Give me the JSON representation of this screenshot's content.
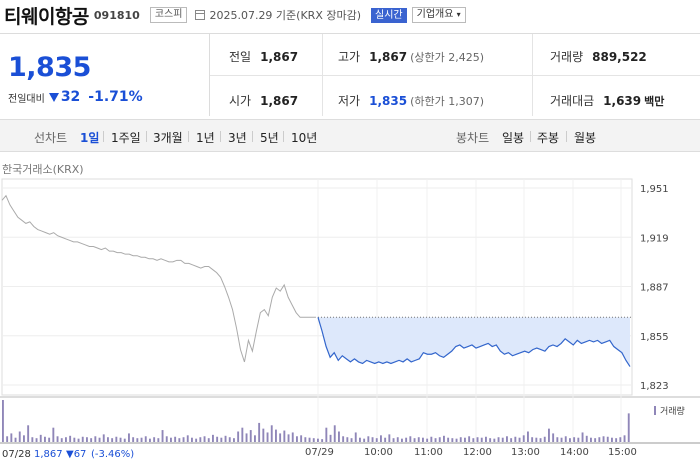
{
  "stock": {
    "name": "티웨이항공",
    "code": "091810",
    "market": "코스피",
    "date": "2025.07.29 기준(KRX 장마감)",
    "realtime": "실시간",
    "company_info": "기업개요"
  },
  "price": {
    "current": "1,835",
    "change_label": "전일대비",
    "change": "32",
    "change_pct": "-1.71%"
  },
  "stats": {
    "prev_close_label": "전일",
    "prev_close": "1,867",
    "high_label": "고가",
    "high": "1,867",
    "upper_limit": "(상한가 2,425)",
    "volume_label": "거래량",
    "volume": "889,522",
    "open_label": "시가",
    "open": "1,867",
    "low_label": "저가",
    "low": "1,835",
    "lower_limit": "(하한가 1,307)",
    "amount_label": "거래대금",
    "amount": "1,639",
    "amount_unit": "백만"
  },
  "tabs": {
    "line_label": "선차트",
    "line_items": [
      "1일",
      "1주일",
      "3개월",
      "1년",
      "3년",
      "5년",
      "10년"
    ],
    "active": "1일",
    "candle_label": "봉차트",
    "candle_items": [
      "일봉",
      "주봉",
      "월봉"
    ]
  },
  "colors": {
    "price_down": "#1a4fd6",
    "prev_line": "#aaaaaa",
    "today_line": "#3366cc",
    "fill": "#dde8fb",
    "volume_bar": "#8f86b8"
  },
  "chart_data": {
    "type": "line",
    "source_label": "한국거래소(KRX)",
    "y_ticks": [
      1951,
      1919,
      1887,
      1855,
      1823
    ],
    "ylim": [
      1823,
      1951
    ],
    "x_labels": [
      "07/28",
      "07/29",
      "10:00",
      "11:00",
      "12:00",
      "13:00",
      "14:00",
      "15:00"
    ],
    "volume_label": "거래량",
    "prev_day_summary": {
      "date": "07/28",
      "close": "1,867",
      "change": "▼67",
      "change_pct": "(-3.46%)"
    },
    "series": [
      {
        "day": "07/28",
        "values": [
          1943,
          1946,
          1940,
          1936,
          1932,
          1930,
          1928,
          1929,
          1926,
          1924,
          1923,
          1922,
          1921,
          1922,
          1920,
          1919,
          1918,
          1917,
          1916,
          1916,
          1915,
          1914,
          1913,
          1913,
          1912,
          1911,
          1912,
          1910,
          1910,
          1909,
          1909,
          1908,
          1908,
          1907,
          1907,
          1906,
          1906,
          1905,
          1905,
          1904,
          1905,
          1904,
          1903,
          1903,
          1904,
          1904,
          1902,
          1902,
          1901,
          1900,
          1899,
          1900,
          1900,
          1898,
          1896,
          1893,
          1887,
          1880,
          1872,
          1860,
          1846,
          1838,
          1852,
          1845,
          1858,
          1870,
          1872,
          1868,
          1880,
          1886,
          1884,
          1888,
          1880,
          1875,
          1870,
          1867,
          1867,
          1867,
          1867,
          1867
        ]
      },
      {
        "day": "07/29",
        "values": [
          1867,
          1858,
          1848,
          1841,
          1844,
          1839,
          1842,
          1840,
          1838,
          1840,
          1838,
          1837,
          1839,
          1838,
          1837,
          1838,
          1837,
          1838,
          1837,
          1838,
          1839,
          1838,
          1840,
          1838,
          1839,
          1840,
          1844,
          1843,
          1843,
          1844,
          1842,
          1841,
          1843,
          1845,
          1848,
          1849,
          1847,
          1848,
          1849,
          1847,
          1848,
          1849,
          1850,
          1848,
          1849,
          1845,
          1843,
          1844,
          1842,
          1843,
          1844,
          1845,
          1844,
          1846,
          1847,
          1846,
          1845,
          1848,
          1849,
          1848,
          1850,
          1853,
          1851,
          1849,
          1852,
          1850,
          1851,
          1852,
          1851,
          1852,
          1850,
          1851,
          1852,
          1848,
          1846,
          1844,
          1839,
          1835
        ]
      }
    ],
    "volume": [
      88,
      12,
      18,
      9,
      22,
      14,
      35,
      10,
      8,
      15,
      11,
      9,
      30,
      12,
      8,
      10,
      13,
      9,
      7,
      11,
      10,
      8,
      12,
      9,
      16,
      10,
      8,
      11,
      9,
      7,
      18,
      10,
      8,
      9,
      12,
      7,
      10,
      8,
      25,
      12,
      9,
      11,
      8,
      10,
      14,
      9,
      7,
      10,
      12,
      8,
      15,
      11,
      9,
      13,
      10,
      8,
      22,
      30,
      18,
      25,
      14,
      40,
      28,
      20,
      35,
      26,
      18,
      24,
      16,
      20,
      12,
      14,
      10,
      9,
      8,
      7,
      6,
      30,
      15,
      35,
      22,
      12,
      10,
      8,
      20,
      9,
      7,
      12,
      10,
      8,
      14,
      9,
      16,
      8,
      10,
      7,
      9,
      12,
      8,
      10,
      9,
      7,
      11,
      8,
      10,
      13,
      9,
      8,
      7,
      10,
      9,
      12,
      8,
      10,
      9,
      11,
      8,
      7,
      10,
      9,
      12,
      8,
      11,
      9,
      14,
      22,
      10,
      9,
      8,
      11,
      28,
      18,
      10,
      9,
      12,
      8,
      10,
      9,
      20,
      13,
      9,
      8,
      10,
      12,
      11,
      9,
      8,
      10,
      14,
      60
    ]
  }
}
